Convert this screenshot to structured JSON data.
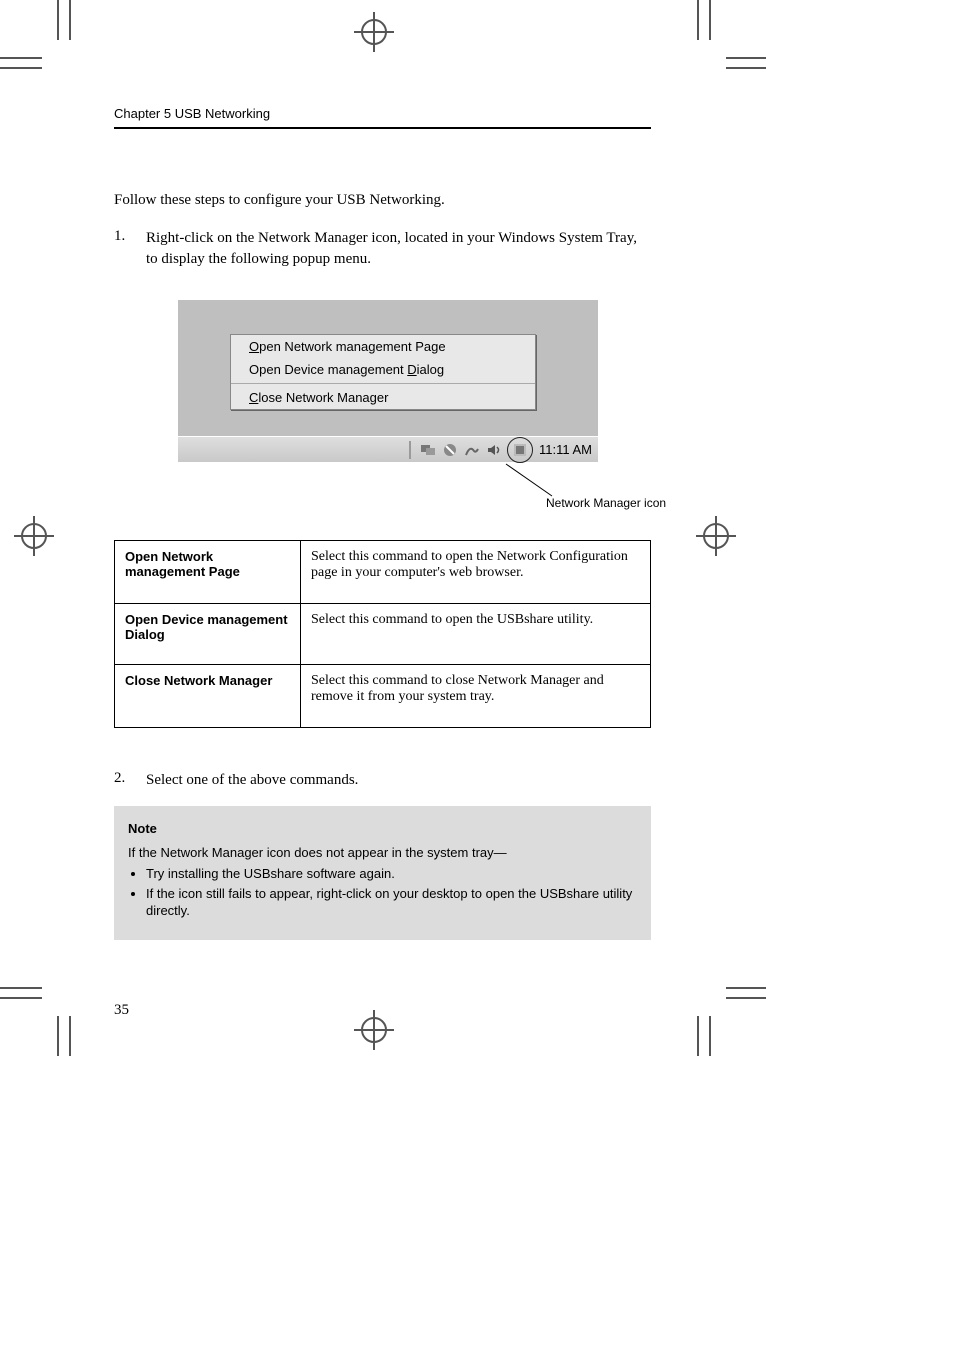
{
  "running_header": "Chapter 5  USB Networking",
  "intro": "Follow these steps to configure your USB Networking.",
  "step1": {
    "num": "1.",
    "text": "Right-click on the Network Manager icon, located in your Windows System Tray, to display the following popup menu."
  },
  "menu": {
    "item1_pre": "",
    "item1_u": "O",
    "item1_post": "pen Network management Page",
    "item2_pre": "Open Device management ",
    "item2_u": "D",
    "item2_post": "ialog",
    "item3_pre": "",
    "item3_u": "C",
    "item3_post": "lose Network Manager"
  },
  "taskbar_time": "11:11 AM",
  "callout": "Network Manager icon",
  "table": {
    "r1c1": "Open Network management Page",
    "r1c2": "Select this command to open the Network Configuration page in your computer's web browser.",
    "r2c1": "Open Device management Dialog",
    "r2c2": "Select this command to open the USBshare utility.",
    "r3c1": "Close Network Manager",
    "r3c2": "Select this command to close Network Manager and remove it from your system tray."
  },
  "step2": {
    "num": "2.",
    "text": "Select one of the above commands."
  },
  "note": {
    "title": "Note",
    "lead": "If the Network Manager icon does not appear in the system tray—",
    "bullets": [
      "Try installing the USBshare software again.",
      "If the icon still fails to appear, right-click on your desktop to open the USBshare utility directly."
    ]
  },
  "page_number": "35"
}
